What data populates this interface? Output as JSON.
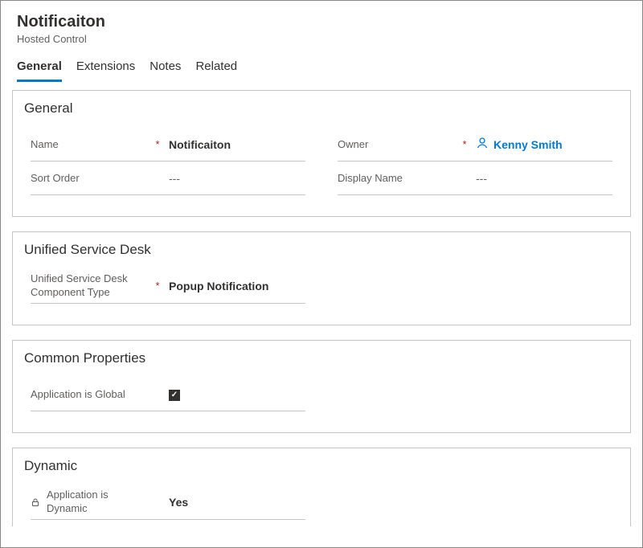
{
  "header": {
    "title": "Notificaiton",
    "subtitle": "Hosted Control"
  },
  "tabs": [
    {
      "label": "General",
      "active": true
    },
    {
      "label": "Extensions",
      "active": false
    },
    {
      "label": "Notes",
      "active": false
    },
    {
      "label": "Related",
      "active": false
    }
  ],
  "sections": {
    "general": {
      "title": "General",
      "name_label": "Name",
      "name_value": "Notificaiton",
      "owner_label": "Owner",
      "owner_value": "Kenny Smith",
      "sort_order_label": "Sort Order",
      "sort_order_value": "---",
      "display_name_label": "Display Name",
      "display_name_value": "---"
    },
    "usd": {
      "title": "Unified Service Desk",
      "component_type_label": "Unified Service Desk Component Type",
      "component_type_value": "Popup Notification"
    },
    "common": {
      "title": "Common Properties",
      "global_label": "Application is Global",
      "global_checked": true
    },
    "dynamic": {
      "title": "Dynamic",
      "app_dynamic_label": "Application is Dynamic",
      "app_dynamic_value": "Yes"
    }
  }
}
